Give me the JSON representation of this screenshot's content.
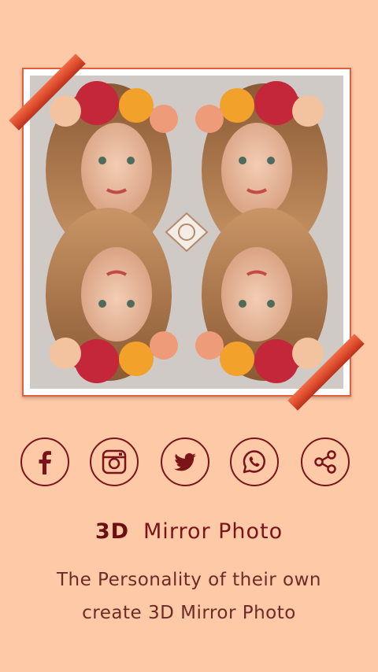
{
  "photo": {
    "description_icon": "mirror-photo-image"
  },
  "social": [
    {
      "name": "facebook",
      "icon": "facebook-icon"
    },
    {
      "name": "instagram",
      "icon": "instagram-icon"
    },
    {
      "name": "twitter",
      "icon": "twitter-icon"
    },
    {
      "name": "whatsapp",
      "icon": "whatsapp-icon"
    },
    {
      "name": "share",
      "icon": "share-icon"
    }
  ],
  "title": {
    "prefix": "3D",
    "main": "Mirror Photo"
  },
  "subtitle": {
    "line1": "The Personality of their own",
    "line2": "create 3D Mirror Photo"
  },
  "colors": {
    "background": "#fdc9a6",
    "accent": "#7a1418",
    "frame": "#e2603e"
  }
}
